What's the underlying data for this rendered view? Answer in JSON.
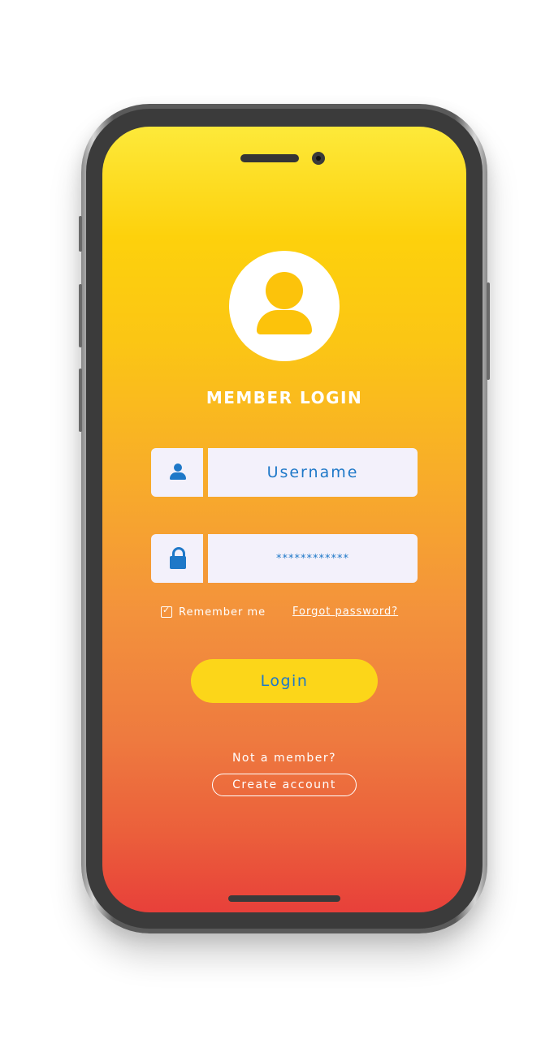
{
  "login": {
    "title": "MEMBER LOGIN",
    "username_placeholder": "Username",
    "password_value": "************",
    "remember_label": "Remember me",
    "remember_checked": true,
    "forgot_label": "Forgot password?",
    "login_label": "Login",
    "not_member_text": "Not a member?",
    "create_account_label": "Create account"
  },
  "icons": {
    "avatar": "user-avatar-icon",
    "username": "user-icon",
    "password": "lock-icon",
    "checkbox": "check-icon"
  },
  "colors": {
    "gradient_top": "#fde93a",
    "gradient_bottom": "#e8403a",
    "accent_blue": "#1e78c8",
    "login_button": "#fcd619",
    "field_bg": "#f3f1fb",
    "avatar_fill": "#fcc30b"
  }
}
